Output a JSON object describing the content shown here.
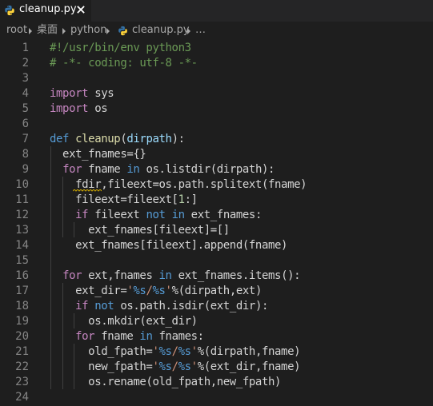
{
  "colors": {
    "background": "#1e1e1e",
    "tabbar": "#252526",
    "line_number": "#858585",
    "comment": "#6a9955",
    "keyword": "#c586c0",
    "def_keyword": "#569cd6",
    "function_name": "#dcdcaa",
    "parameter": "#9cdcfe",
    "string": "#ce9178",
    "number": "#b5cea8",
    "warning_squiggle": "#cca700",
    "python_icon_blue": "#3572a5",
    "python_icon_yellow": "#ffd43b"
  },
  "tab": {
    "label": "cleanup.py",
    "icon": "python-icon",
    "close_icon": "close-icon"
  },
  "breadcrumb": {
    "items": [
      "root",
      "桌面",
      "python",
      "cleanup.py",
      "…"
    ],
    "separator_icon": "chevron-right-icon"
  },
  "editor": {
    "line_numbers": [
      "1",
      "2",
      "3",
      "4",
      "5",
      "6",
      "7",
      "8",
      "9",
      "10",
      "11",
      "12",
      "13",
      "14",
      "15",
      "16",
      "17",
      "18",
      "19",
      "20",
      "21",
      "22",
      "23",
      "24"
    ],
    "lines": [
      [
        [
          "comment",
          "#!/usr/bin/env python3"
        ]
      ],
      [
        [
          "comment",
          "# -*- coding: utf-8 -*-"
        ]
      ],
      [],
      [
        [
          "keyword",
          "import"
        ],
        [
          "plain",
          " sys"
        ]
      ],
      [
        [
          "keyword",
          "import"
        ],
        [
          "plain",
          " os"
        ]
      ],
      [],
      [
        [
          "def",
          "def"
        ],
        [
          "plain",
          " "
        ],
        [
          "func",
          "cleanup"
        ],
        [
          "plain",
          "("
        ],
        [
          "param",
          "dirpath"
        ],
        [
          "plain",
          "):"
        ]
      ],
      [
        [
          "plain",
          "  ext_fnames={}"
        ]
      ],
      [
        [
          "plain",
          "  "
        ],
        [
          "keyword",
          "for"
        ],
        [
          "plain",
          " fname "
        ],
        [
          "op",
          "in"
        ],
        [
          "plain",
          " os.listdir(dirpath):"
        ]
      ],
      [
        [
          "plain",
          "    fdir,fileext=os.path.splitext(fname)"
        ]
      ],
      [
        [
          "plain",
          "    fileext=fileext["
        ],
        [
          "number",
          "1"
        ],
        [
          "plain",
          ":]"
        ]
      ],
      [
        [
          "plain",
          "    "
        ],
        [
          "keyword",
          "if"
        ],
        [
          "plain",
          " fileext "
        ],
        [
          "op",
          "not"
        ],
        [
          "plain",
          " "
        ],
        [
          "op",
          "in"
        ],
        [
          "plain",
          " ext_fnames:"
        ]
      ],
      [
        [
          "plain",
          "      ext_fnames[fileext]=[]"
        ]
      ],
      [
        [
          "plain",
          "    ext_fnames[fileext].append(fname)"
        ]
      ],
      [],
      [
        [
          "plain",
          "  "
        ],
        [
          "keyword",
          "for"
        ],
        [
          "plain",
          " ext,fnames "
        ],
        [
          "op",
          "in"
        ],
        [
          "plain",
          " ext_fnames.items():"
        ]
      ],
      [
        [
          "plain",
          "    ext_dir="
        ],
        [
          "string",
          "'"
        ],
        [
          "format",
          "%s"
        ],
        [
          "string",
          "/"
        ],
        [
          "format",
          "%s"
        ],
        [
          "string",
          "'"
        ],
        [
          "plain",
          "%(dirpath,ext)"
        ]
      ],
      [
        [
          "plain",
          "    "
        ],
        [
          "keyword",
          "if"
        ],
        [
          "plain",
          " "
        ],
        [
          "op",
          "not"
        ],
        [
          "plain",
          " os.path.isdir(ext_dir):"
        ]
      ],
      [
        [
          "plain",
          "      os.mkdir(ext_dir)"
        ]
      ],
      [
        [
          "plain",
          "    "
        ],
        [
          "keyword",
          "for"
        ],
        [
          "plain",
          " fname "
        ],
        [
          "op",
          "in"
        ],
        [
          "plain",
          " fnames:"
        ]
      ],
      [
        [
          "plain",
          "      old_fpath="
        ],
        [
          "string",
          "'"
        ],
        [
          "format",
          "%s"
        ],
        [
          "string",
          "/"
        ],
        [
          "format",
          "%s"
        ],
        [
          "string",
          "'"
        ],
        [
          "plain",
          "%(dirpath,fname)"
        ]
      ],
      [
        [
          "plain",
          "      new_fpath="
        ],
        [
          "string",
          "'"
        ],
        [
          "format",
          "%s"
        ],
        [
          "string",
          "/"
        ],
        [
          "format",
          "%s"
        ],
        [
          "string",
          "'"
        ],
        [
          "plain",
          "%(ext_dir,fname)"
        ]
      ],
      [
        [
          "plain",
          "      os.rename(old_fpath,new_fpath)"
        ]
      ],
      []
    ]
  }
}
